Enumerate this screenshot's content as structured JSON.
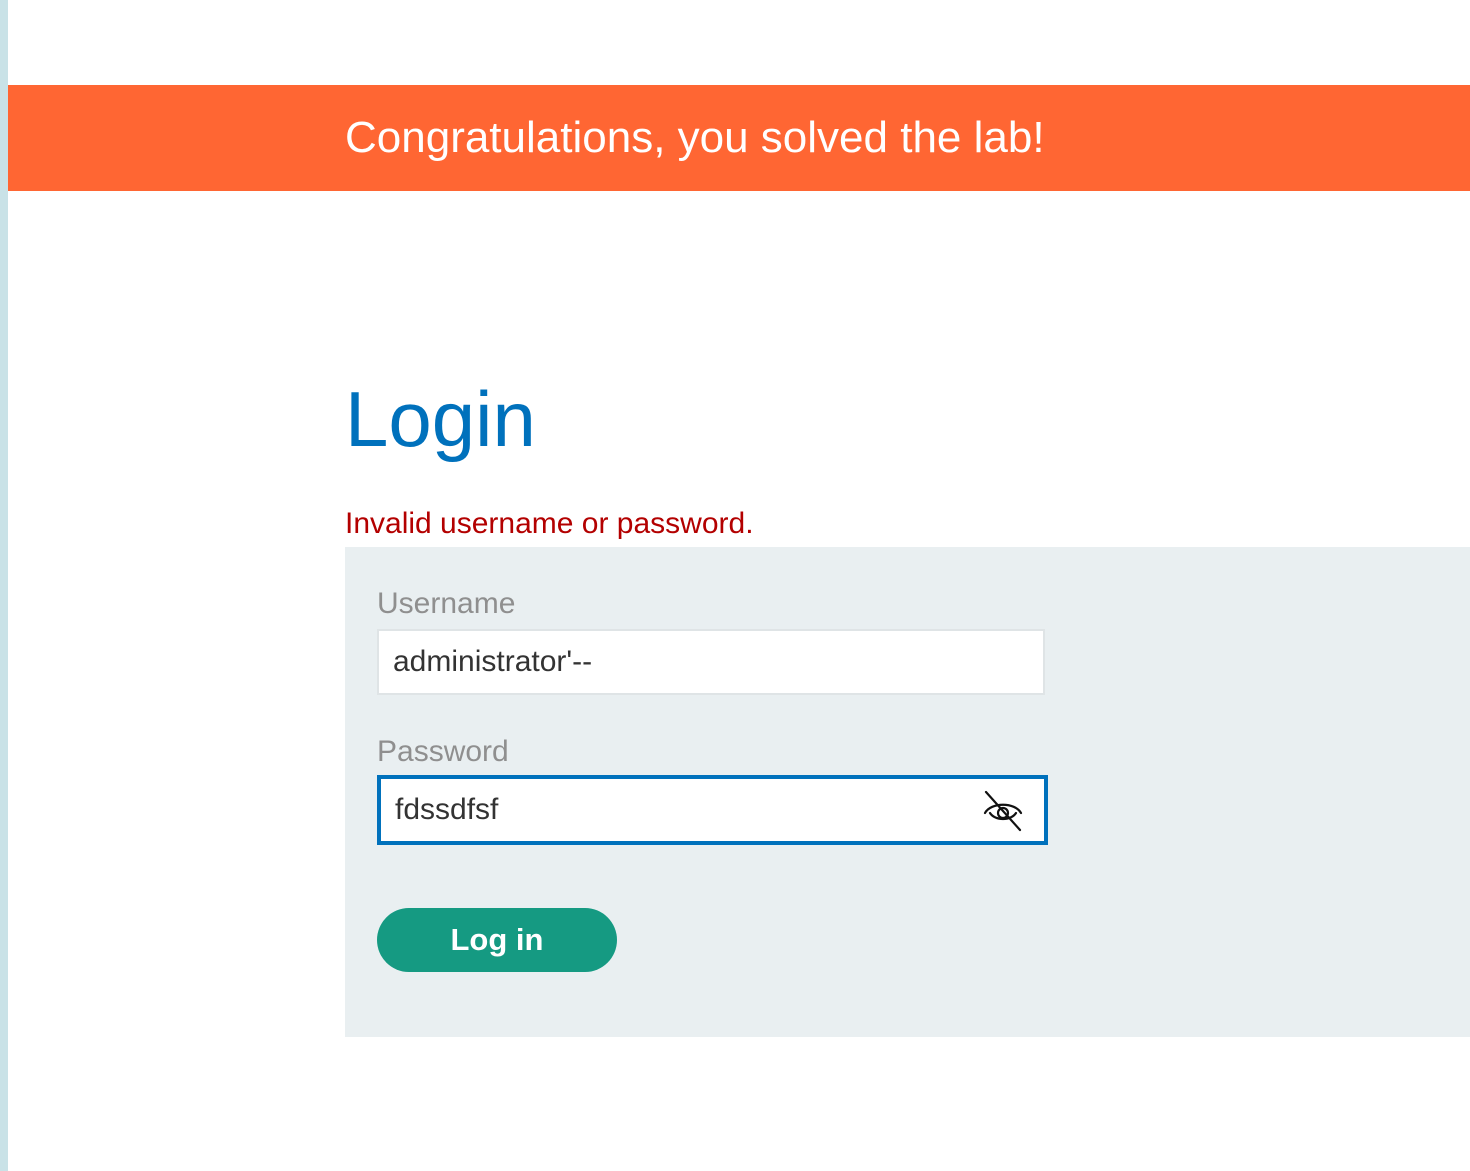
{
  "banner": {
    "message": "Congratulations, you solved the lab!"
  },
  "login": {
    "title": "Login",
    "error": "Invalid username or password.",
    "username": {
      "label": "Username",
      "value": "administrator'--"
    },
    "password": {
      "label": "Password",
      "value": "fdssdfsf",
      "visible": true,
      "toggle_icon": "eye-off-icon"
    },
    "submit_label": "Log in"
  },
  "colors": {
    "banner": "#ff6633",
    "title": "#0071bc",
    "error": "#b30000",
    "panel": "#e9eff1",
    "button": "#159a82",
    "focus_border": "#0071bc"
  }
}
